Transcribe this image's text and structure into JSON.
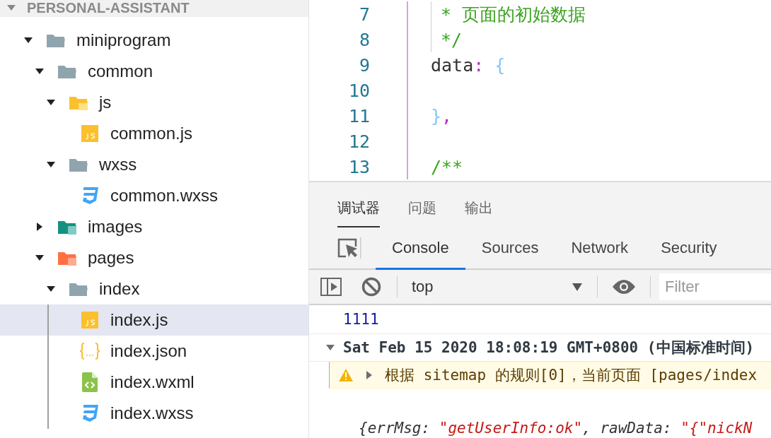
{
  "explorer": {
    "title": "PERSONAL-ASSISTANT",
    "expanded": true,
    "tree": [
      {
        "name": "miniprogram",
        "kind": "folder",
        "expanded": true,
        "selected": false,
        "children": [
          {
            "name": "common",
            "kind": "folder",
            "expanded": true,
            "selected": false,
            "children": [
              {
                "name": "js",
                "kind": "folder-js",
                "expanded": true,
                "selected": false,
                "children": [
                  {
                    "name": "common.js",
                    "kind": "js",
                    "selected": false
                  }
                ]
              },
              {
                "name": "wxss",
                "kind": "folder",
                "expanded": true,
                "selected": false,
                "children": [
                  {
                    "name": "common.wxss",
                    "kind": "wxss",
                    "selected": false
                  }
                ]
              }
            ]
          },
          {
            "name": "images",
            "kind": "folder-images",
            "expanded": false,
            "selected": false
          },
          {
            "name": "pages",
            "kind": "folder-pages",
            "expanded": true,
            "selected": false,
            "children": [
              {
                "name": "index",
                "kind": "folder",
                "expanded": true,
                "selected": false,
                "children": [
                  {
                    "name": "index.js",
                    "kind": "js",
                    "selected": true
                  },
                  {
                    "name": "index.json",
                    "kind": "json",
                    "selected": false
                  },
                  {
                    "name": "index.wxml",
                    "kind": "wxml",
                    "selected": false
                  },
                  {
                    "name": "index.wxss",
                    "kind": "wxss",
                    "selected": false
                  }
                ]
              }
            ]
          }
        ]
      }
    ]
  },
  "editor": {
    "lines": [
      {
        "number": "7",
        "guide": true,
        "segments": [
          {
            "text": "* 页面的初始数据",
            "kind": "comment"
          }
        ]
      },
      {
        "number": "8",
        "guide": true,
        "segments": [
          {
            "text": "*/",
            "kind": "comment"
          }
        ]
      },
      {
        "number": "9",
        "guide": false,
        "segments": [
          {
            "text": "data",
            "kind": "plain"
          },
          {
            "text": ":",
            "kind": "punct"
          },
          {
            "text": " {",
            "kind": "brace"
          }
        ]
      },
      {
        "number": "10",
        "guide": false
      },
      {
        "number": "11",
        "guide": false,
        "segments": [
          {
            "text": "}",
            "kind": "brace"
          },
          {
            "text": ",",
            "kind": "punct"
          }
        ]
      },
      {
        "number": "12",
        "guide": false
      },
      {
        "number": "13",
        "guide": false,
        "segments": [
          {
            "text": "/**",
            "kind": "comment"
          }
        ]
      }
    ]
  },
  "devtools": {
    "panel_tabs": [
      {
        "label": "调试器",
        "selected": true
      },
      {
        "label": "问题",
        "selected": false
      },
      {
        "label": "输出",
        "selected": false
      }
    ],
    "tool_tabs": [
      {
        "label": "Console",
        "selected": true
      },
      {
        "label": "Sources",
        "selected": false
      },
      {
        "label": "Network",
        "selected": false
      },
      {
        "label": "Security",
        "selected": false
      }
    ],
    "context": "top",
    "filter": {
      "placeholder": "Filter"
    },
    "messages": [
      {
        "kind": "log",
        "text": "1111"
      },
      {
        "kind": "group",
        "expanded": true,
        "text": "Sat Feb 15 2020 18:08:19 GMT+0800 (中国标准时间)"
      },
      {
        "kind": "warning",
        "expanded": false,
        "text": "根据 sitemap 的规则[0]，当前页面 [pages/index"
      },
      {
        "kind": "object",
        "segments": [
          {
            "text": "{errMsg: ",
            "kind": "plain"
          },
          {
            "text": "\"getUserInfo:ok\"",
            "kind": "string"
          },
          {
            "text": ", rawData: ",
            "kind": "plain"
          },
          {
            "text": "\"{\"nickN",
            "kind": "string"
          }
        ]
      }
    ]
  }
}
